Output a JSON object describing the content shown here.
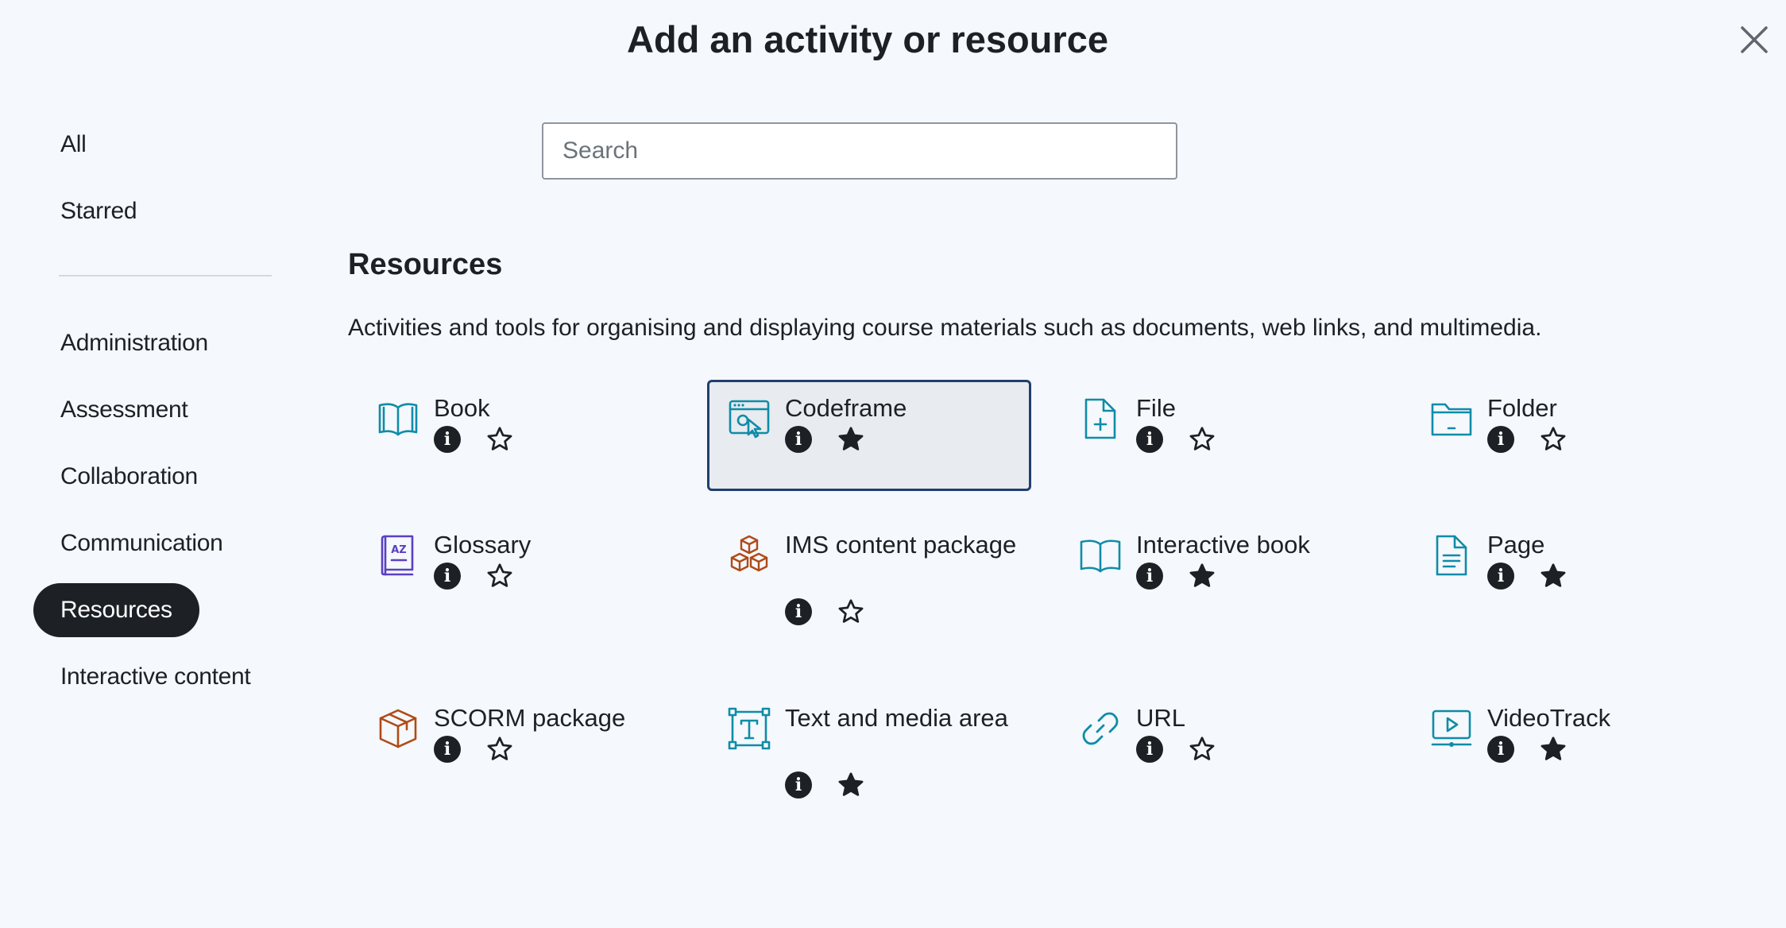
{
  "modal": {
    "title": "Add an activity or resource"
  },
  "search": {
    "placeholder": "Search"
  },
  "nav": {
    "items": [
      {
        "label": "All"
      },
      {
        "label": "Starred"
      },
      {
        "label": "Administration"
      },
      {
        "label": "Assessment"
      },
      {
        "label": "Collaboration"
      },
      {
        "label": "Communication"
      },
      {
        "label": "Resources",
        "active": true
      },
      {
        "label": "Interactive content"
      }
    ]
  },
  "section": {
    "title": "Resources",
    "description": "Activities and tools for organising and displaying course materials such as documents, web links, and multimedia."
  },
  "tiles": [
    {
      "name": "Book",
      "icon": "book-icon",
      "starred": false
    },
    {
      "name": "Codeframe",
      "icon": "codeframe-icon",
      "starred": true,
      "selected": true
    },
    {
      "name": "File",
      "icon": "file-icon",
      "starred": false
    },
    {
      "name": "Folder",
      "icon": "folder-icon",
      "starred": false
    },
    {
      "name": "Glossary",
      "icon": "glossary-icon",
      "starred": false
    },
    {
      "name": "IMS content package",
      "icon": "ims-package-icon",
      "starred": false
    },
    {
      "name": "Interactive book",
      "icon": "interactive-book-icon",
      "starred": true
    },
    {
      "name": "Page",
      "icon": "page-icon",
      "starred": true
    },
    {
      "name": "SCORM package",
      "icon": "scorm-package-icon",
      "starred": false
    },
    {
      "name": "Text and media area",
      "icon": "text-media-icon",
      "starred": true
    },
    {
      "name": "URL",
      "icon": "url-link-icon",
      "starred": false
    },
    {
      "name": "VideoTrack",
      "icon": "video-icon",
      "starred": true
    }
  ],
  "icons": {
    "info": "info-icon",
    "star": "star-icon",
    "close": "close-icon"
  },
  "colors": {
    "teal": "#0f8ca8",
    "orange": "#b04a17",
    "purple": "#5b3fc4",
    "dark": "#1d2125",
    "selected_border": "#1f3f6e",
    "selected_bg": "#e8ebef"
  }
}
